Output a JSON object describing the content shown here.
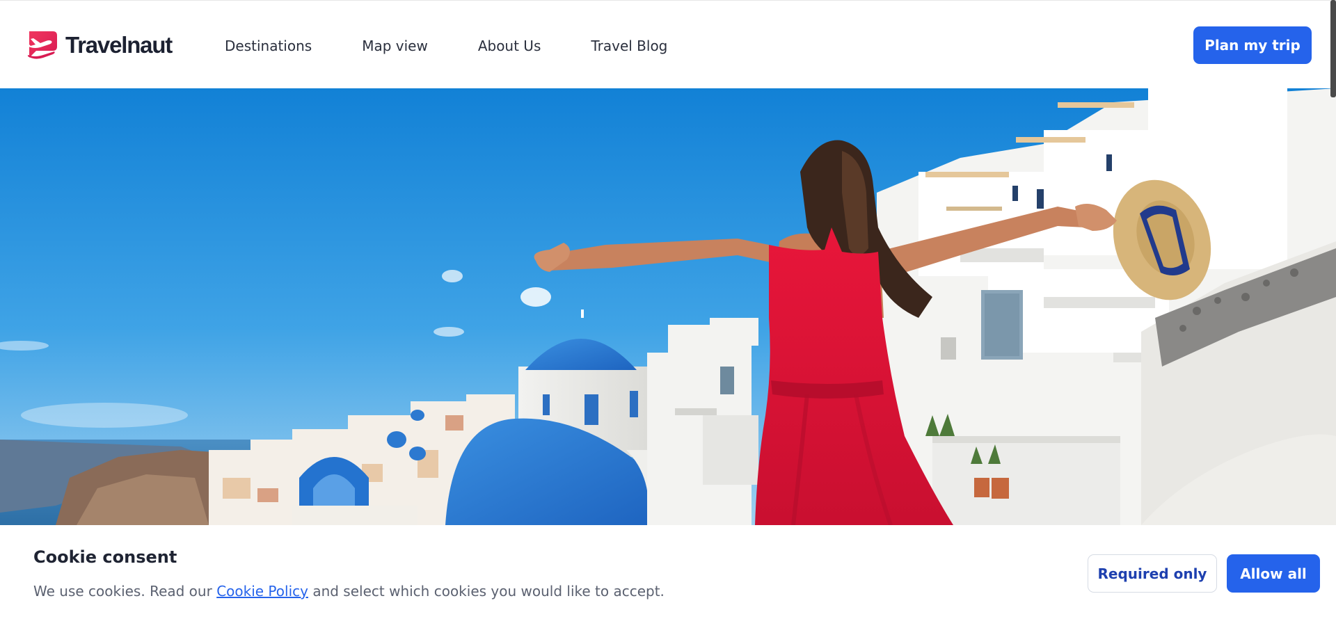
{
  "brand": {
    "name": "Travelnaut",
    "logo_icon": "travelnaut-plane-logo-icon",
    "accent_color": "#e8235a"
  },
  "nav": {
    "items": [
      {
        "label": "Destinations"
      },
      {
        "label": "Map view"
      },
      {
        "label": "About Us"
      },
      {
        "label": "Travel Blog"
      }
    ]
  },
  "header": {
    "cta_label": "Plan my trip",
    "cta_color": "#2563eb"
  },
  "hero": {
    "image_description_icon": "santorini-hero-image"
  },
  "cookie": {
    "title": "Cookie consent",
    "text_before_link": "We use cookies. Read our ",
    "link_label": "Cookie Policy",
    "text_after_link": " and select which cookies you would like to accept.",
    "required_only_label": "Required only",
    "allow_all_label": "Allow all"
  }
}
